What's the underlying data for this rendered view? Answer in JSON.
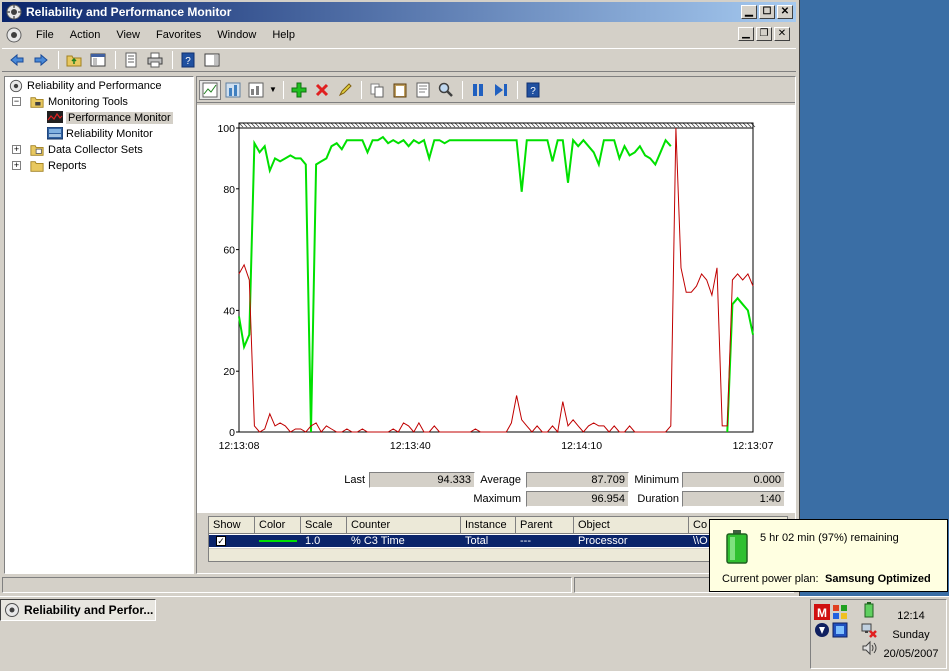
{
  "window": {
    "title": "Reliability and Performance Monitor",
    "menu": [
      "File",
      "Action",
      "View",
      "Favorites",
      "Window",
      "Help"
    ]
  },
  "tree": {
    "root": "Reliability and Performance",
    "monitoring_tools": "Monitoring Tools",
    "performance_monitor": "Performance Monitor",
    "reliability_monitor": "Reliability Monitor",
    "data_collector_sets": "Data Collector Sets",
    "reports": "Reports"
  },
  "stats": {
    "last_label": "Last",
    "last_value": "94.333",
    "average_label": "Average",
    "average_value": "87.709",
    "minimum_label": "Minimum",
    "minimum_value": "0.000",
    "maximum_label": "Maximum",
    "maximum_value": "96.954",
    "duration_label": "Duration",
    "duration_value": "1:40"
  },
  "legend": {
    "headers": [
      "Show",
      "Color",
      "Scale",
      "Counter",
      "Instance",
      "Parent",
      "Object",
      "Co"
    ],
    "row": {
      "scale": "1.0",
      "counter": "% C3 Time",
      "instance": "Total",
      "parent": "---",
      "object": "Processor",
      "computer": "\\\\O"
    }
  },
  "taskbar": {
    "task_label": "Reliability and Perfor...",
    "clock_time": "12:14",
    "clock_day": "Sunday",
    "clock_date": "20/05/2007"
  },
  "battery_popup": {
    "remaining": "5 hr 02 min (97%) remaining",
    "plan_label": "Current power plan:",
    "plan_value": "Samsung Optimized"
  },
  "colors": {
    "green_series": "#00e000",
    "red_series": "#c00000",
    "titlebar": "#0a246a",
    "selection": "#0a246a"
  },
  "chart_data": {
    "type": "line",
    "ylim": [
      0,
      100
    ],
    "yticks": [
      "100",
      "80",
      "60",
      "40",
      "20",
      "0"
    ],
    "xticks": [
      "12:13:08",
      "12:13:40",
      "12:14:10",
      "12:13:07"
    ],
    "series": [
      {
        "color": "#00e000",
        "values": [
          38,
          28,
          32,
          95,
          92,
          94,
          86,
          90,
          89,
          90,
          91,
          90,
          90,
          88,
          0,
          88,
          89,
          90,
          94,
          95,
          93,
          96,
          96,
          96,
          96,
          92,
          96,
          96,
          97,
          95,
          96,
          95,
          96,
          94,
          96,
          95,
          96,
          90,
          96,
          96,
          95,
          96,
          96,
          96,
          96,
          96,
          96,
          96,
          96,
          96,
          96,
          96,
          96,
          96,
          96,
          79,
          96,
          96,
          96,
          96,
          96,
          89,
          96,
          96,
          82,
          96,
          94,
          96,
          94,
          92,
          88,
          96,
          96,
          96,
          90,
          94,
          91,
          92,
          94,
          91,
          90,
          88,
          92,
          96,
          94,
          null,
          null,
          null,
          null,
          null,
          null,
          null,
          null,
          null,
          null,
          0,
          42,
          44,
          42,
          40,
          32
        ]
      },
      {
        "color": "#c00000",
        "values": [
          52,
          55,
          50,
          2,
          0,
          1,
          6,
          2,
          3,
          2,
          0,
          1,
          1,
          0,
          2,
          3,
          0,
          2,
          1,
          0,
          0,
          1,
          0,
          0,
          1,
          0,
          0,
          0,
          0,
          0,
          1,
          0,
          3,
          2,
          0,
          3,
          0,
          0,
          2,
          0,
          0,
          0,
          0,
          0,
          0,
          0,
          1,
          0,
          0,
          0,
          0,
          0,
          0,
          3,
          12,
          4,
          2,
          0,
          2,
          0,
          0,
          2,
          0,
          10,
          2,
          4,
          2,
          0,
          2,
          3,
          2,
          2,
          0,
          2,
          0,
          0,
          2,
          0,
          0,
          0,
          0,
          0,
          0,
          0,
          2,
          100,
          54,
          46,
          46,
          48,
          52,
          50,
          45,
          54,
          2,
          2,
          50,
          52,
          50,
          52,
          48
        ]
      }
    ]
  }
}
